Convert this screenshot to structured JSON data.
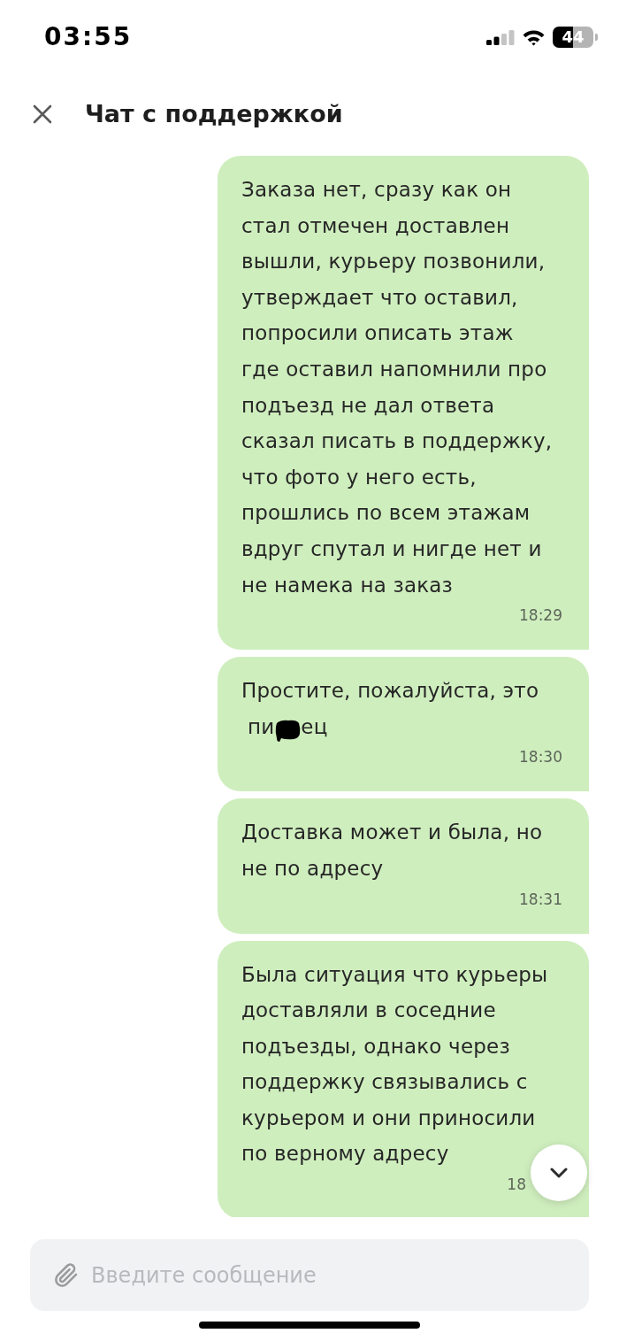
{
  "status_bar": {
    "time": "03:55",
    "battery": "44"
  },
  "header": {
    "title": "Чат с поддержкой"
  },
  "messages": [
    {
      "parts": [
        {
          "kind": "text",
          "text": "Заказа нет, сразу как он стал отмечен доставлен вышли, курьеру позвонили, утверждает что оставил, попросили описать этаж где оставил напомнили про подъезд не дал ответа сказал писать в поддержку, что фото у него есть, прошлись по всем этажам вдруг спутал и нигде нет и не намека на заказ"
        }
      ],
      "time": "18:29"
    },
    {
      "parts": [
        {
          "kind": "text",
          "text": "Простите, пожалуйста, это"
        },
        {
          "kind": "censored_word",
          "start": "пи",
          "end": "ец"
        }
      ],
      "time": "18:30"
    },
    {
      "parts": [
        {
          "kind": "text",
          "text": "Доставка может и была, но не по адресу"
        }
      ],
      "time": "18:31"
    },
    {
      "parts": [
        {
          "kind": "text",
          "text": "Была ситуация что курьеры доставляли в соседние подъезды, однако через поддержку связывались с курьером и они приносили по верному адресу"
        }
      ],
      "time": "18"
    }
  ],
  "composer": {
    "placeholder": "Введите сообщение"
  }
}
